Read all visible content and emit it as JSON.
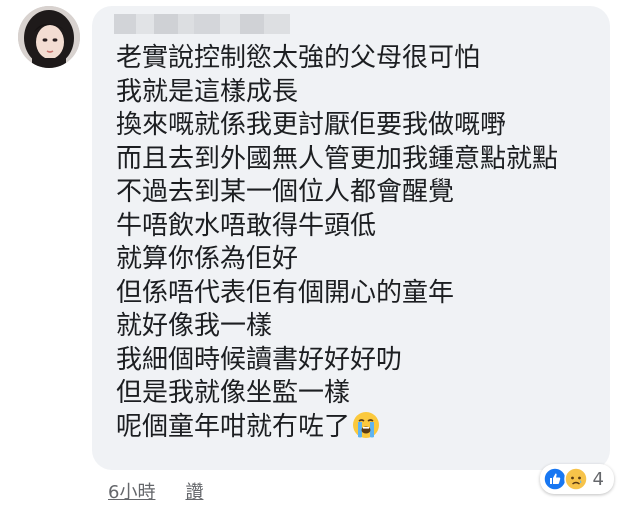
{
  "comment": {
    "lines": [
      "老實說控制慾太強的父母很可怕",
      "我就是這樣成長",
      "換來嘅就係我更討厭佢要我做嘅嘢",
      "而且去到外國無人管更加我鍾意點就點",
      "不過去到某一個位人都會醒覺",
      "牛唔飲水唔敢得牛頭低",
      "就算你係為佢好",
      "但係唔代表佢有個開心的童年",
      "就好像我一樣",
      "我細個時候讀書好好好叻",
      "但是我就像坐監一樣",
      "呢個童年咁就冇咗了"
    ],
    "emoji_icon": "loudly-crying-face-emoji",
    "bubble_color": "#f0f2f5",
    "text_color": "#1c1e21"
  },
  "meta": {
    "time": "6小時",
    "action": "讚"
  },
  "reactions": {
    "icons": [
      "like-icon",
      "sad-face-icon"
    ],
    "count": "4",
    "like_color": "#1877f2",
    "sad_color": "#f7c34a"
  }
}
